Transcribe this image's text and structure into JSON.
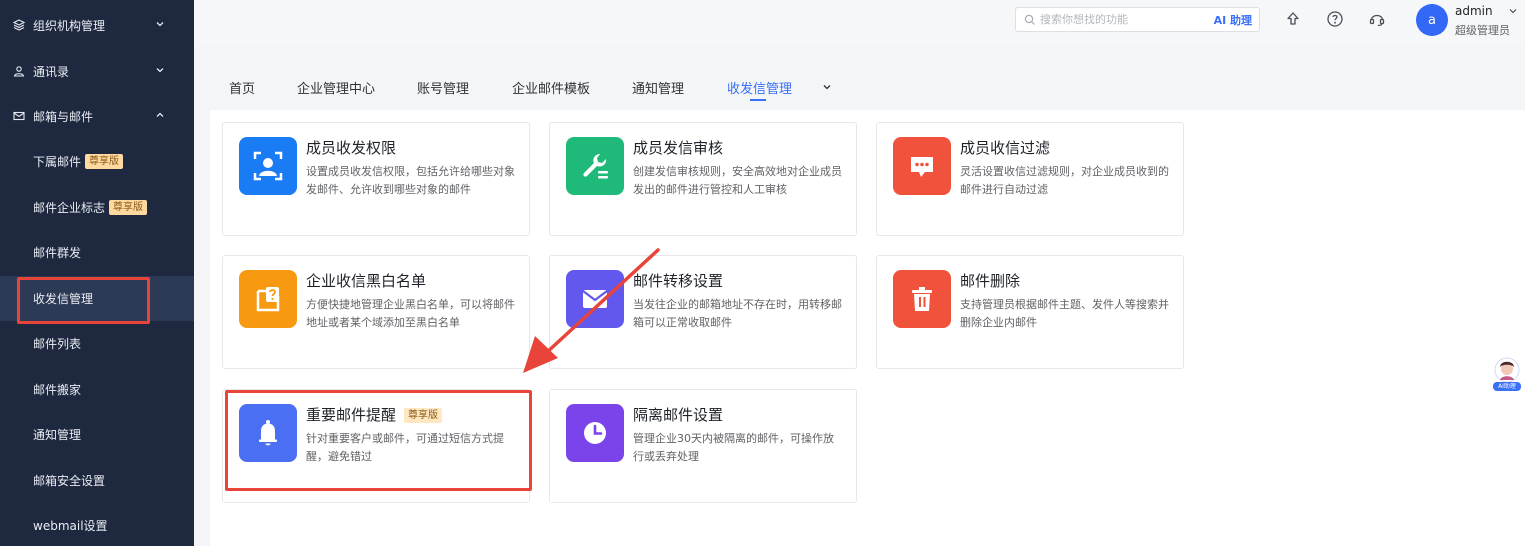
{
  "sidebar": {
    "groups": [
      {
        "label": "组织机构管理",
        "icon": "org-icon"
      },
      {
        "label": "通讯录",
        "icon": "contacts-icon"
      },
      {
        "label": "邮箱与邮件",
        "icon": "mail-icon"
      }
    ],
    "items": [
      {
        "label": "下属邮件",
        "badge": "尊享版"
      },
      {
        "label": "邮件企业标志",
        "badge": "尊享版"
      },
      {
        "label": "邮件群发"
      },
      {
        "label": "收发信管理"
      },
      {
        "label": "邮件列表"
      },
      {
        "label": "邮件搬家"
      },
      {
        "label": "通知管理"
      },
      {
        "label": "邮箱安全设置"
      },
      {
        "label": "webmail设置"
      }
    ]
  },
  "header": {
    "search_placeholder": "搜索你想找的功能",
    "ai_label": "AI 助理",
    "user": {
      "avatar_letter": "a",
      "name": "admin",
      "role": "超级管理员"
    }
  },
  "tabs": [
    "首页",
    "企业管理中心",
    "账号管理",
    "企业邮件模板",
    "通知管理",
    "收发信管理"
  ],
  "cards": [
    {
      "title": "成员收发权限",
      "desc": "设置成员收发信权限，包括允许给哪些对象发邮件、允许收到哪些对象的邮件",
      "icon": "member-face-icon",
      "color": "#1a7cf5"
    },
    {
      "title": "成员发信审核",
      "desc": "创建发信审核规则，安全高效地对企业成员发出的邮件进行管控和人工审核",
      "icon": "wrench-icon",
      "color": "#1fb97a"
    },
    {
      "title": "成员收信过滤",
      "desc": "灵活设置收信过滤规则，对企业成员收到的邮件进行自动过滤",
      "icon": "message-icon",
      "color": "#f0523c"
    },
    {
      "title": "企业收信黑白名单",
      "desc": "方便快捷地管理企业黑白名单，可以将邮件地址或者某个域添加至黑白名单",
      "icon": "list-question-icon",
      "color": "#f79a12"
    },
    {
      "title": "邮件转移设置",
      "desc": "当发往企业的邮箱地址不存在时，用转移邮箱可以正常收取邮件",
      "icon": "envelope-icon",
      "color": "#6258ee"
    },
    {
      "title": "邮件删除",
      "desc": "支持管理员根据邮件主题、发件人等搜索并删除企业内邮件",
      "icon": "trash-icon",
      "color": "#f0523c"
    },
    {
      "title": "重要邮件提醒",
      "badge": "尊享版",
      "desc": "针对重要客户或邮件，可通过短信方式提醒，避免错过",
      "icon": "bell-icon",
      "color": "#4a6ff2"
    },
    {
      "title": "隔离邮件设置",
      "desc": "管理企业30天内被隔离的邮件，可操作放行或丢弃处理",
      "icon": "clock-icon",
      "color": "#7b44ea"
    }
  ],
  "floating": {
    "label": "AI助理"
  }
}
